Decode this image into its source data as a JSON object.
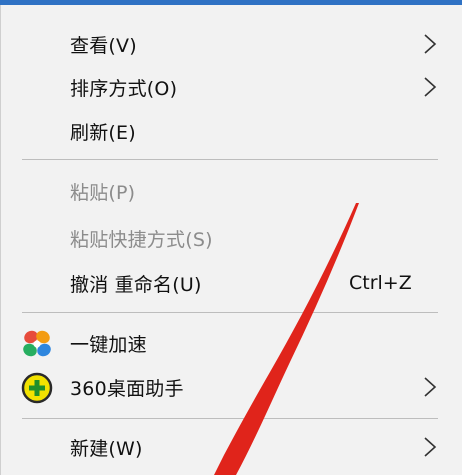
{
  "context_menu": {
    "items": [
      {
        "label": "查看(V)",
        "has_submenu": true
      },
      {
        "label": "排序方式(O)",
        "has_submenu": true
      },
      {
        "label": "刷新(E)"
      },
      {
        "label": "粘贴(P)",
        "disabled": true
      },
      {
        "label": "粘贴快捷方式(S)",
        "disabled": true
      },
      {
        "label": "撤消 重命名(U)",
        "shortcut": "Ctrl+Z"
      },
      {
        "label": "一键加速",
        "icon": "speedup-pinwheel-icon"
      },
      {
        "label": "360桌面助手",
        "icon": "360-desktop-assistant-icon",
        "has_submenu": true
      },
      {
        "label": "新建(W)",
        "has_submenu": true
      }
    ]
  },
  "colors": {
    "menu_background": "#f2f2f2",
    "disabled_text": "#8c8c8c",
    "annotation_arrow": "#e0241b",
    "top_bar": "#2f72c4"
  },
  "annotation": {
    "icon": "red-pointer-arrow-icon"
  }
}
